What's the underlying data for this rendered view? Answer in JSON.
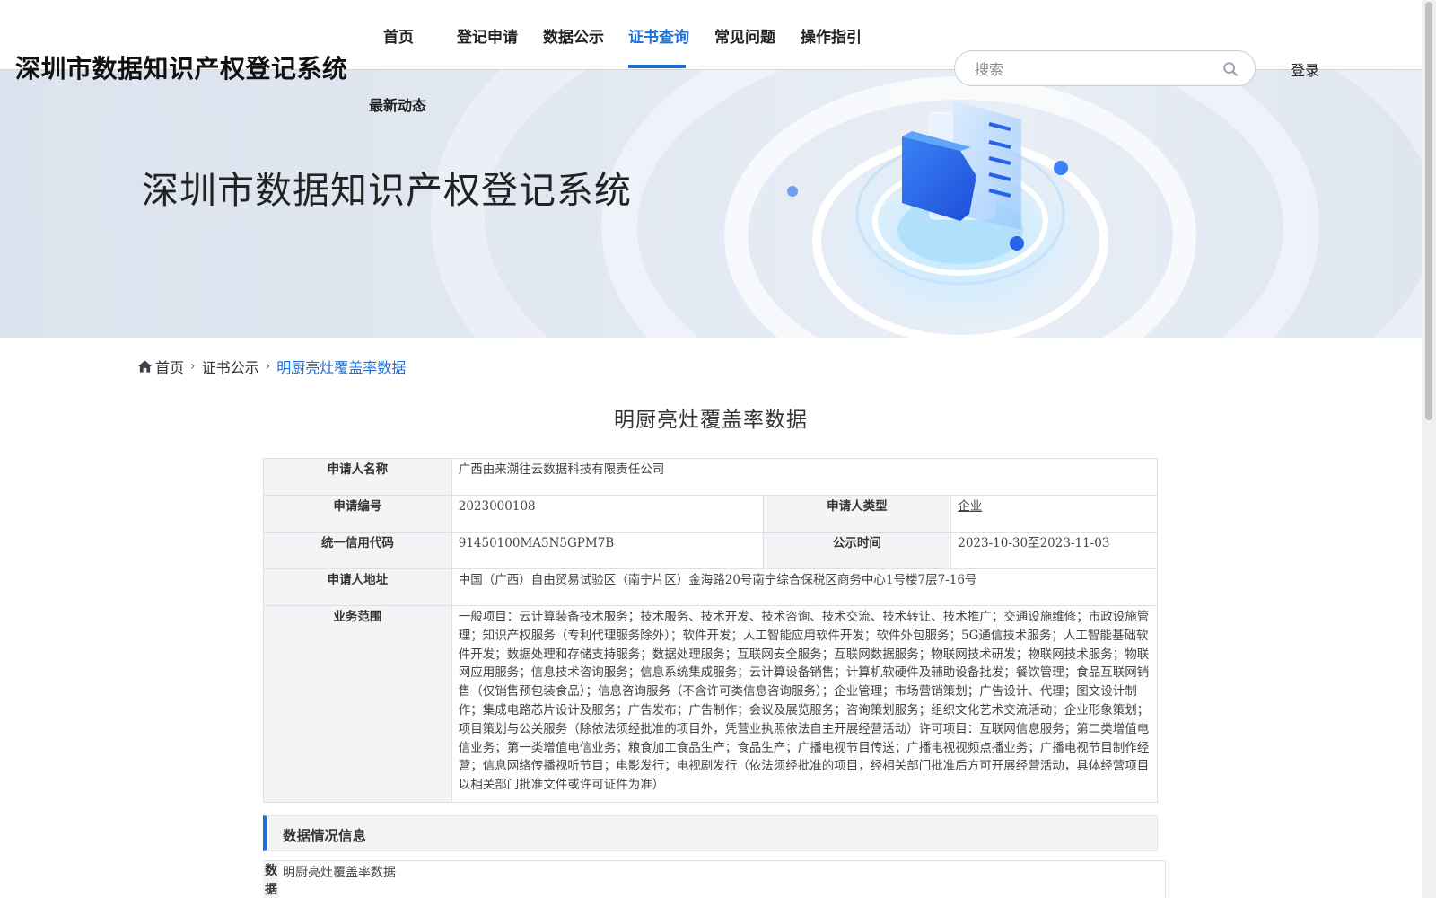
{
  "header": {
    "site_name": "深圳市数据知识产权登记系统",
    "nav": [
      {
        "label": "首页",
        "active": false
      },
      {
        "label": "登记申请",
        "active": false
      },
      {
        "label": "数据公示",
        "active": false
      },
      {
        "label": "证书查询",
        "active": true
      },
      {
        "label": "常见问题",
        "active": false
      },
      {
        "label": "操作指引",
        "active": false
      },
      {
        "label": "最新动态",
        "active": false
      }
    ],
    "search": {
      "placeholder": "搜索",
      "icon": "search-icon"
    },
    "login_label": "登录"
  },
  "banner": {
    "title": "深圳市数据知识产权登记系统"
  },
  "breadcrumb": {
    "home": "首页",
    "home_icon": "home-icon",
    "level2": "证书公示",
    "current": "明厨亮灶覆盖率数据"
  },
  "page_title": "明厨亮灶覆盖率数据",
  "applicant": {
    "name_label": "申请人名称",
    "name": "广西由来溯往云数据科技有限责任公司",
    "app_no_label": "申请编号",
    "app_no": "2023000108",
    "type_label": "申请人类型",
    "type": "企业",
    "credit_code_label": "统一信用代码",
    "credit_code": "91450100MA5N5GPM7B",
    "publicity_label": "公示时间",
    "publicity_time": "2023-10-30至2023-11-03",
    "address_label": "申请人地址",
    "address": "中国（广西）自由贸易试验区（南宁片区）金海路20号南宁综合保税区商务中心1号楼7层7-16号",
    "scope_label": "业务范围",
    "scope": "一般项目：云计算装备技术服务；技术服务、技术开发、技术咨询、技术交流、技术转让、技术推广；交通设施维修；市政设施管理；知识产权服务（专利代理服务除外）；软件开发；人工智能应用软件开发；软件外包服务；5G通信技术服务；人工智能基础软件开发；数据处理和存储支持服务；数据处理服务；互联网安全服务；互联网数据服务；物联网技术研发；物联网技术服务；物联网应用服务；信息技术咨询服务；信息系统集成服务；云计算设备销售；计算机软硬件及辅助设备批发；餐饮管理；食品互联网销售（仅销售预包装食品）；信息咨询服务（不含许可类信息咨询服务）；企业管理；市场营销策划；广告设计、代理；图文设计制作；集成电路芯片设计及服务；广告发布；广告制作；会议及展览服务；咨询策划服务；组织文化艺术交流活动；企业形象策划；项目策划与公关服务（除依法须经批准的项目外，凭营业执照依法自主开展经营活动）许可项目：互联网信息服务；第二类增值电信业务；第一类增值电信业务；粮食加工食品生产；食品生产；广播电视节目传送；广播电视视频点播业务；广播电视节目制作经营；信息网络传播视听节目；电影发行；电视剧发行（依法须经批准的项目，经相关部门批准后方可开展经营活动，具体经营项目以相关部门批准文件或许可证件为准）"
  },
  "data_section": {
    "heading": "数据情况信息",
    "row_label": "数据",
    "row_value": "明厨亮灶覆盖率数据"
  },
  "colors": {
    "accent": "#1f6fd6",
    "label_bg": "#f3f4f6",
    "border": "#dcdfe5"
  }
}
